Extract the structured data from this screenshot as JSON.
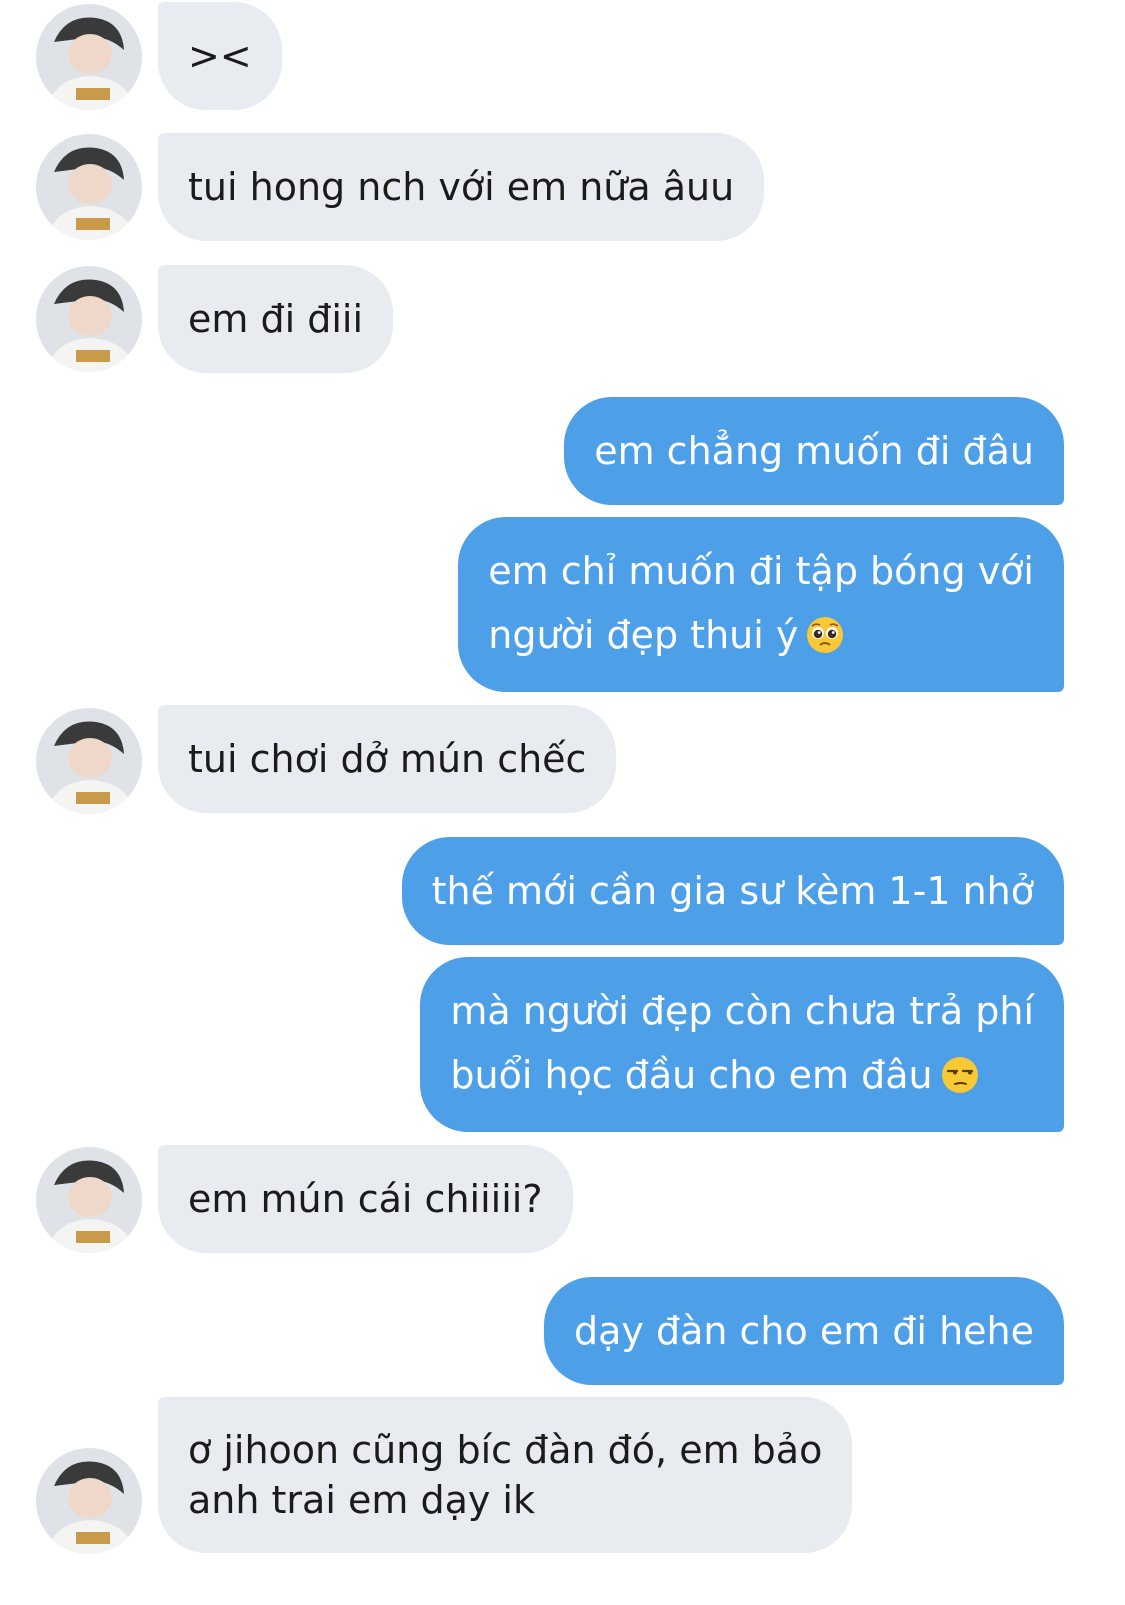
{
  "conversation": {
    "messages": [
      {
        "side": "in",
        "text": "><"
      },
      {
        "side": "in",
        "text": "tui hong nch với em nữa âuu"
      },
      {
        "side": "in",
        "text": "em đi điii"
      },
      {
        "side": "out",
        "text": "em chẳng muốn đi đâu"
      },
      {
        "side": "out",
        "line1": "em chỉ muốn đi tập bóng với",
        "line2": "người đẹp thui ý",
        "emoji": "pleading-face-icon"
      },
      {
        "side": "in",
        "text": "tui chơi dở mún chếc"
      },
      {
        "side": "out",
        "text": "thế mới cần gia sư kèm 1-1 nhở"
      },
      {
        "side": "out",
        "line1": "mà người đẹp còn chưa trả phí",
        "line2": "buổi học đầu cho em đâu",
        "emoji": "unamused-face-icon"
      },
      {
        "side": "in",
        "text": "em mún cái chiiiii?"
      },
      {
        "side": "out",
        "text": "dạy đàn cho em đi hehe"
      },
      {
        "side": "in",
        "line1": "ơ jihoon cũng bíc đàn đó, em bảo",
        "line2": "anh trai em dạy ik"
      }
    ]
  },
  "colors": {
    "incoming_bubble": "#e8ebef",
    "outgoing_bubble": "#4d9fe8",
    "incoming_text": "#1b1b1b",
    "outgoing_text": "#ffffff"
  }
}
